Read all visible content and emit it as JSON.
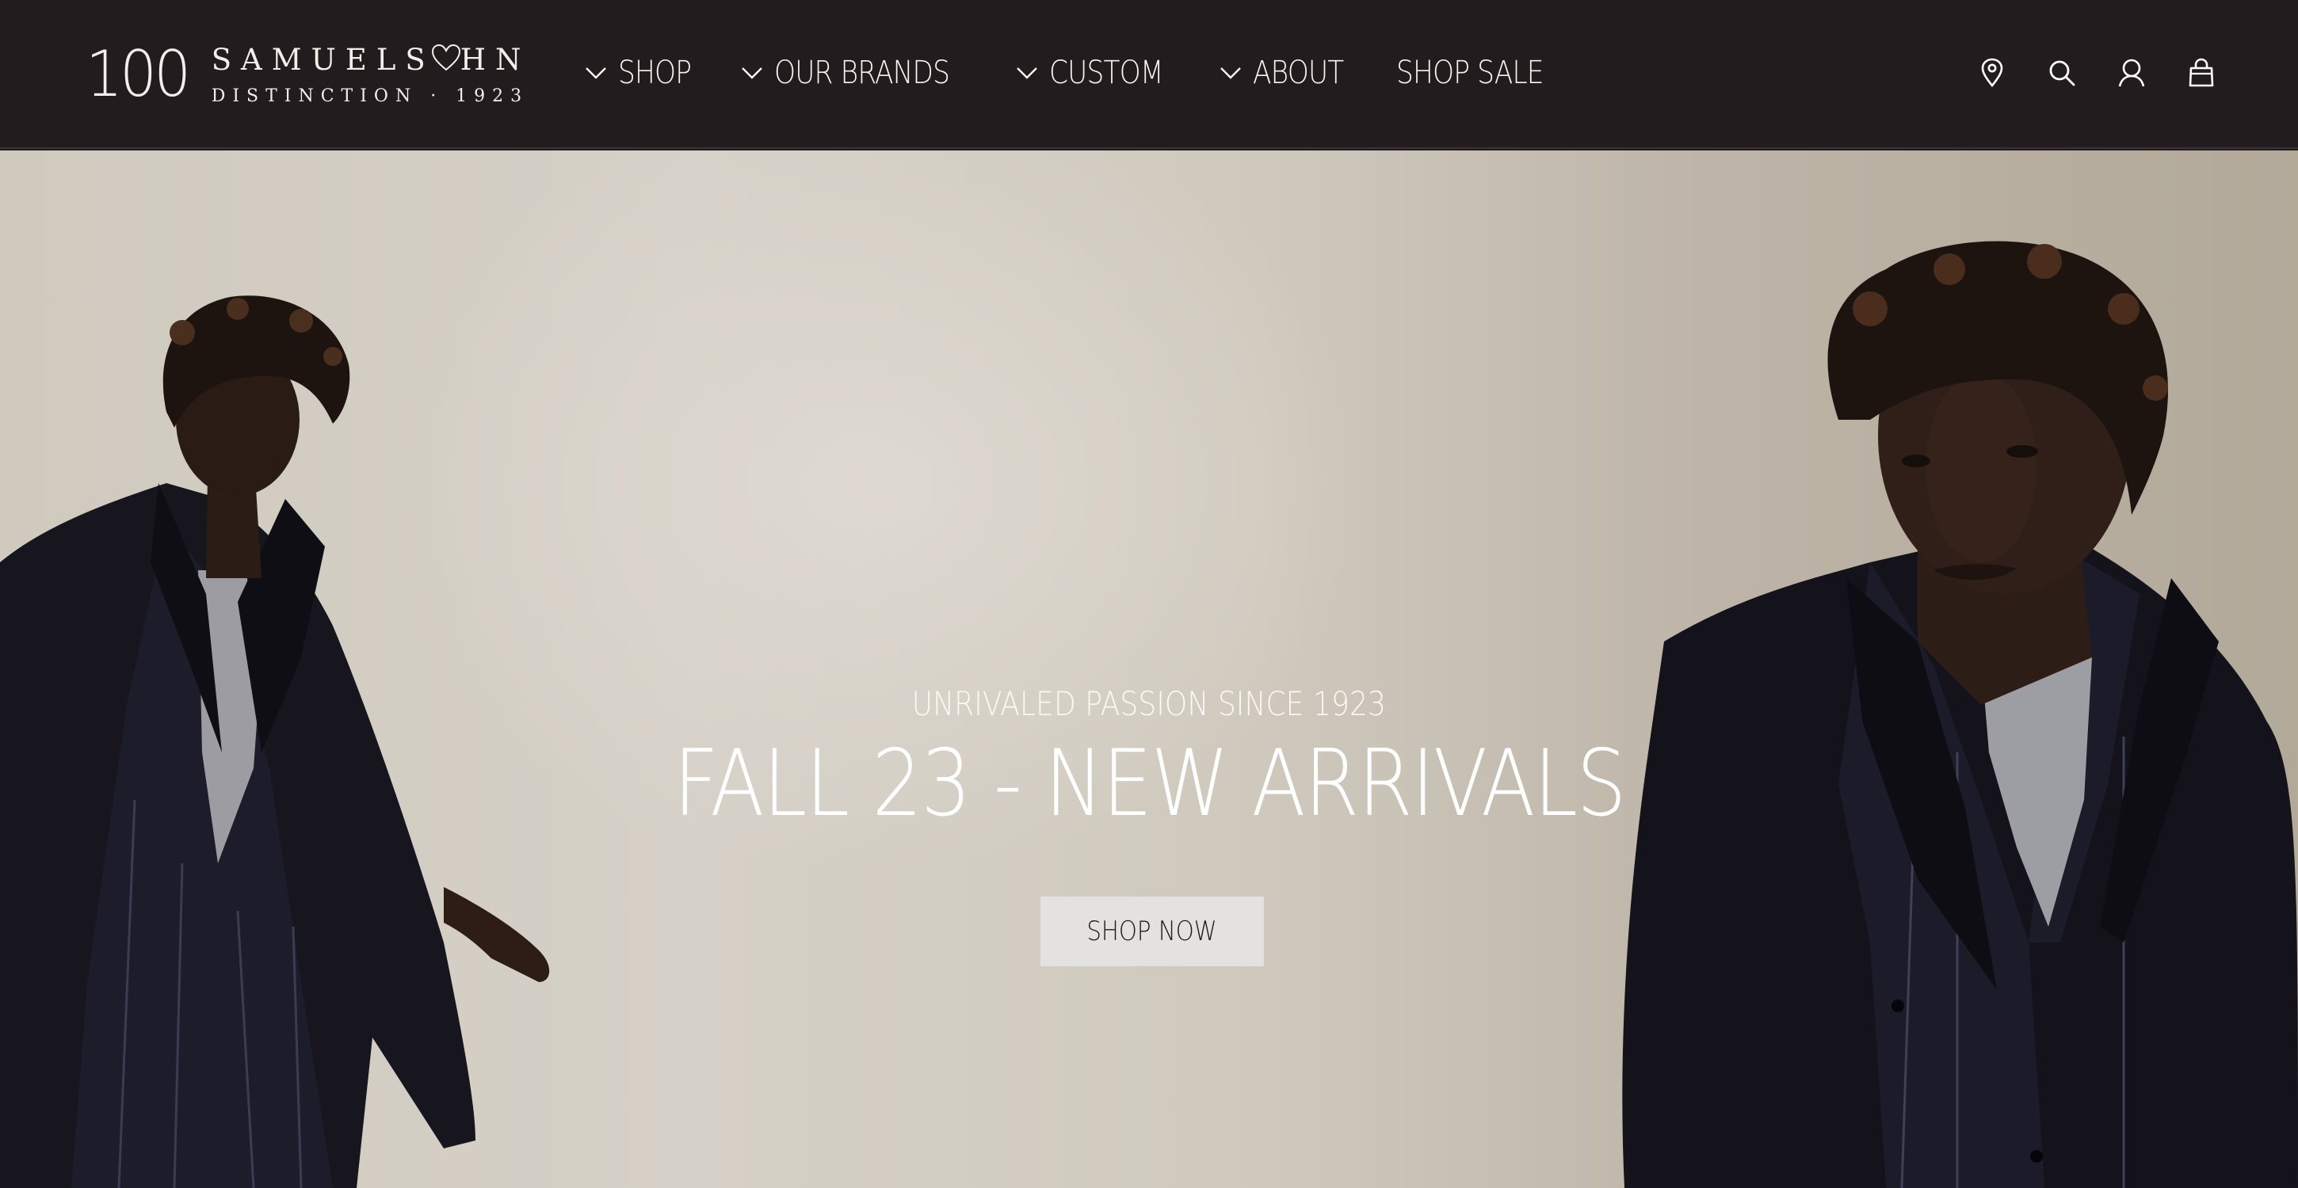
{
  "brand": {
    "logo_number": "100",
    "logo_name_pre": "SAMUELS",
    "logo_name_post": "HN",
    "logo_tagline": "DISTINCTION · 1923",
    "color_background": "#231c1e"
  },
  "nav": {
    "items": [
      {
        "label": "SHOP",
        "has_dropdown": true
      },
      {
        "label": "OUR BRANDS",
        "has_dropdown": true
      },
      {
        "label": "CUSTOM",
        "has_dropdown": true
      },
      {
        "label": "ABOUT",
        "has_dropdown": true
      },
      {
        "label": "SHOP SALE",
        "has_dropdown": false
      }
    ]
  },
  "header_icons": [
    "location-pin-icon",
    "search-icon",
    "account-icon",
    "shopping-bag-icon"
  ],
  "hero": {
    "subtitle": "UNRIVALED PASSION SINCE 1923",
    "title": "FALL 23 - NEW ARRIVALS",
    "cta_label": "SHOP NOW",
    "cta_color": "#e3e2e0"
  }
}
